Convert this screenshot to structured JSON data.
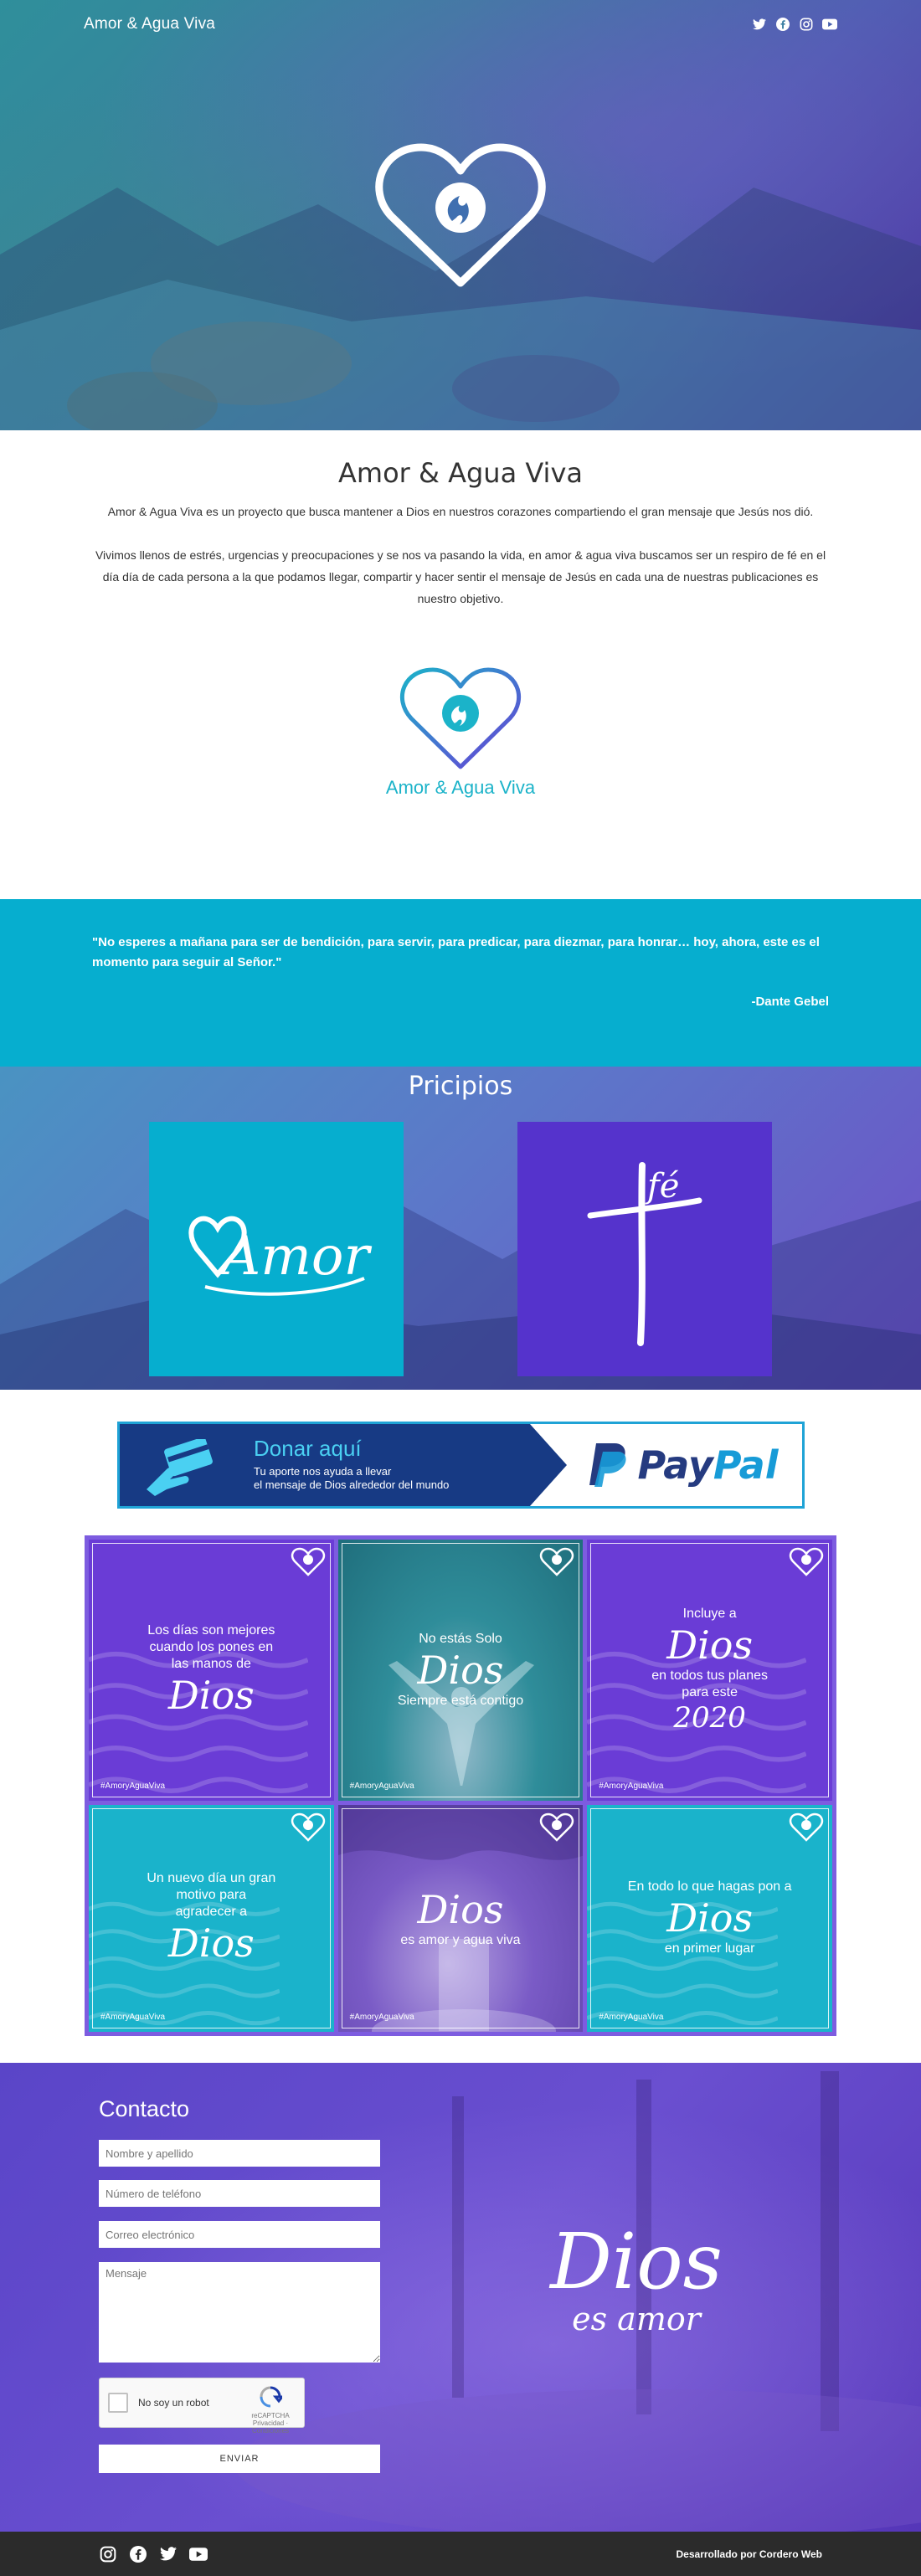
{
  "header": {
    "brand": "Amor & Agua Viva",
    "social": [
      "twitter-icon",
      "facebook-icon",
      "instagram-icon",
      "youtube-icon"
    ]
  },
  "intro": {
    "title": "Amor & Agua Viva",
    "p1": "Amor & Agua Viva es un proyecto que busca mantener a Dios en nuestros corazones compartiendo el gran mensaje que Jesús nos dió.",
    "p2": "Vivimos llenos de estrés, urgencias y preocupaciones y se nos va pasando la vida, en amor & agua viva buscamos ser un respiro de fé en el día día de cada persona a la que podamos llegar, compartir y hacer sentir el mensaje de Jesús en cada una de nuestras publicaciones es nuestro objetivo.",
    "logo_text": "Amor & Agua Viva"
  },
  "quote": {
    "text": "\"No esperes a mañana para ser de bendición, para servir, para predicar, para diezmar, para honrar… hoy, ahora, este es el momento para seguir al Señor.\"",
    "author": "-Dante Gebel"
  },
  "principios": {
    "title": "Pricipios",
    "cards": [
      {
        "label": "Amor"
      },
      {
        "label": "fé"
      }
    ]
  },
  "donate": {
    "title": "Donar aquí",
    "line1": "Tu aporte nos ayuda a llevar",
    "line2": "el mensaje de Dios alrededor del mundo",
    "paypal_pay": "Pay",
    "paypal_pal": "Pal"
  },
  "gallery": {
    "tag": "#AmoryAguaViva",
    "tiles": [
      {
        "top": "Los días son mejores cuando los pones en las manos de",
        "script": "Dios",
        "bottom": "",
        "year": ""
      },
      {
        "top": "No estás Solo",
        "script": "Dios",
        "bottom": "Siempre está contigo",
        "year": ""
      },
      {
        "top": "Incluye a",
        "script": "Dios",
        "bottom": "en todos tus planes para este",
        "year": "2020"
      },
      {
        "top": "Un nuevo día un gran motivo para agradecer a",
        "script": "Dios",
        "bottom": "",
        "year": ""
      },
      {
        "top": "",
        "script": "Dios",
        "bottom": "es amor y agua viva",
        "year": ""
      },
      {
        "top": "En todo lo que hagas pon a",
        "script": "Dios",
        "bottom": "en primer lugar",
        "year": ""
      }
    ]
  },
  "contact": {
    "title": "Contacto",
    "name_placeholder": "Nombre y apellido",
    "phone_placeholder": "Número de teléfono",
    "email_placeholder": "Correo electrónico",
    "message_placeholder": "Mensaje",
    "captcha_label": "No soy un robot",
    "captcha_brand": "reCAPTCHA",
    "captcha_links": "Privacidad · Condiciones",
    "send_label": "ENVIAR",
    "dios": "Dios",
    "es_amor": "es amor"
  },
  "footer": {
    "credit": "Desarrollado por Cordero Web"
  },
  "colors": {
    "teal": "#06aecf",
    "purple": "#5533cc",
    "dark": "#2b2b2b"
  }
}
